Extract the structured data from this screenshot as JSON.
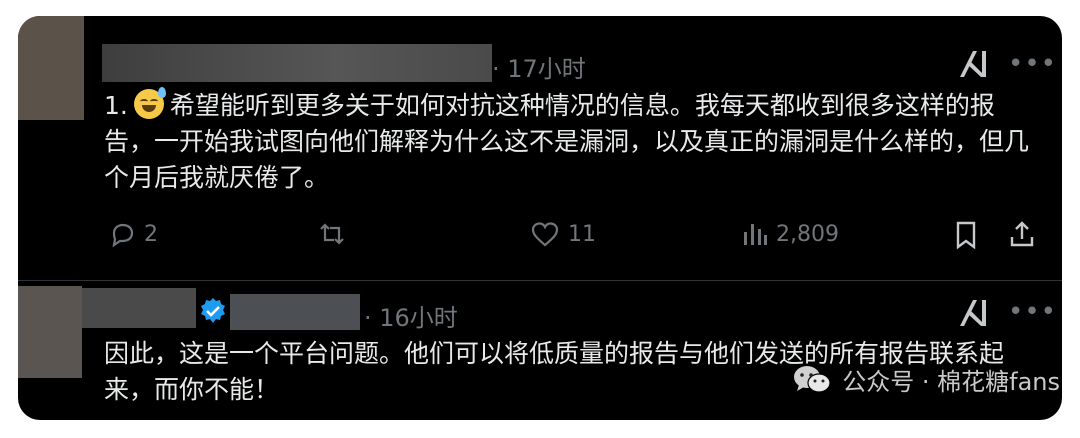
{
  "post1": {
    "time": "· 17小时",
    "text_number": "1.",
    "text": "希望能听到更多关于如何对抗这种情况的信息。我每天都收到很多这样的报告，一开始我试图向他们解释为什么这不是漏洞，以及真正的漏洞是什么样的，但几个月后我就厌倦了。",
    "actions": {
      "reply_count": "2",
      "repost_count": "",
      "like_count": "11",
      "views_count": "2,809"
    }
  },
  "post2": {
    "time": "· 16小时",
    "text": "因此，这是一个平台问题。他们可以将低质量的报告与他们发送的所有报告联系起来，而你不能！"
  },
  "watermark": {
    "text": "公众号 · 棉花糖fans"
  }
}
